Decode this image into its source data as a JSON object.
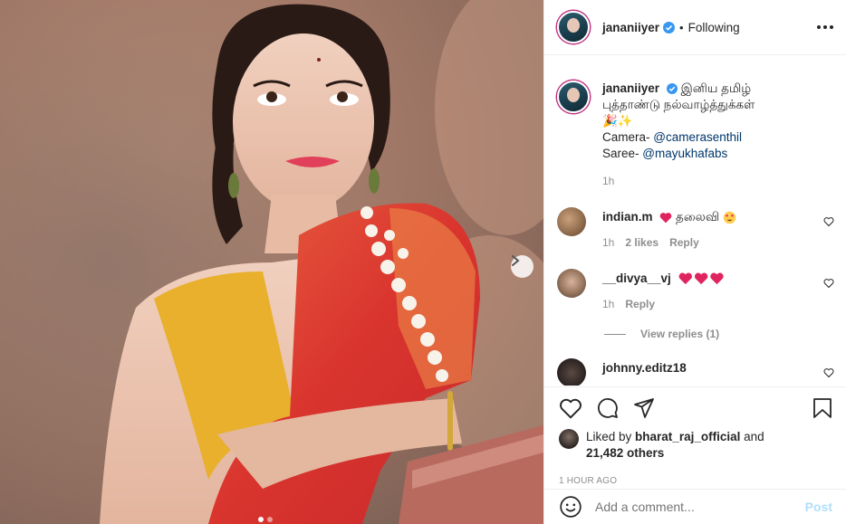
{
  "post": {
    "username": "janan iiyer",
    "following_label": "Following",
    "separator": "•",
    "carousel_slide": 1,
    "carousel_total": 2
  },
  "caption": {
    "username": "jananiiyer",
    "text_line1": "இனிய தமிழ்",
    "text_line2": "புத்தாண்டு நல்வாழ்த்துக்கள்",
    "emoji": "🎉✨",
    "camera_prefix": "Camera- ",
    "camera_mention": "@camerasenthil",
    "saree_prefix": "Saree- ",
    "saree_mention": "@mayukhafabs",
    "time": "1h"
  },
  "comments": [
    {
      "username": "indian.m",
      "text": "தலைவி",
      "time": "1h",
      "likes": "2 likes",
      "reply": "Reply"
    },
    {
      "username": "__divya__vj",
      "text": "",
      "time": "1h",
      "reply": "Reply",
      "view_replies": "View replies (1)"
    },
    {
      "username": "johnny.editz18",
      "text": ""
    }
  ],
  "likes": {
    "prefix": "Liked by ",
    "user": "bharat_raj_official",
    "mid": " and",
    "count": "21,482 others"
  },
  "timestamp": "1 HOUR AGO",
  "add_comment": {
    "placeholder": "Add a comment...",
    "post_label": "Post"
  },
  "colors": {
    "verified": "#3897f0",
    "heart_red": "#ed4956",
    "post_disabled": "#b2dffc",
    "meta_gray": "#8e8e8e"
  }
}
